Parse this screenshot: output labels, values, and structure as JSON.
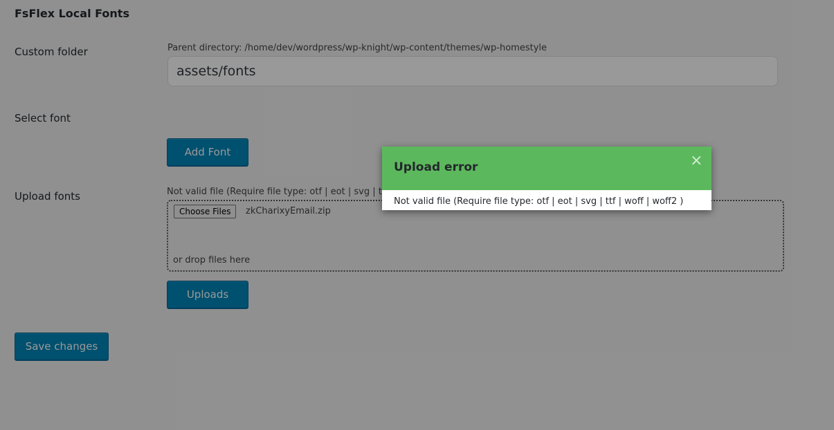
{
  "section": {
    "title": "FsFlex Local Fonts"
  },
  "custom_folder": {
    "label": "Custom folder",
    "parent_directory": "Parent directory: /home/dev/wordpress/wp-knight/wp-content/themes/wp-homestyle",
    "value": "assets/fonts"
  },
  "select_font": {
    "label": "Select font",
    "add_button": "Add Font"
  },
  "upload_fonts": {
    "label": "Upload fonts",
    "validation_message": "Not valid file (Require file type: otf | eot | svg | ttf | woff | woff2 )",
    "choose_files_button": "Choose Files",
    "selected_file": "zkCharixyEmail.zip",
    "drop_hint": "or drop files here",
    "upload_button": "Uploads"
  },
  "save_button": "Save changes",
  "modal": {
    "title": "Upload error",
    "close_icon": "close-icon",
    "close_glyph": "×",
    "message": "Not valid file (Require file type: otf | eot | svg | ttf | woff | woff2 )",
    "header_color": "#5cb85c"
  },
  "colors": {
    "primary_button": "#0085ba",
    "overlay": "rgba(0,0,0,0.4)"
  }
}
